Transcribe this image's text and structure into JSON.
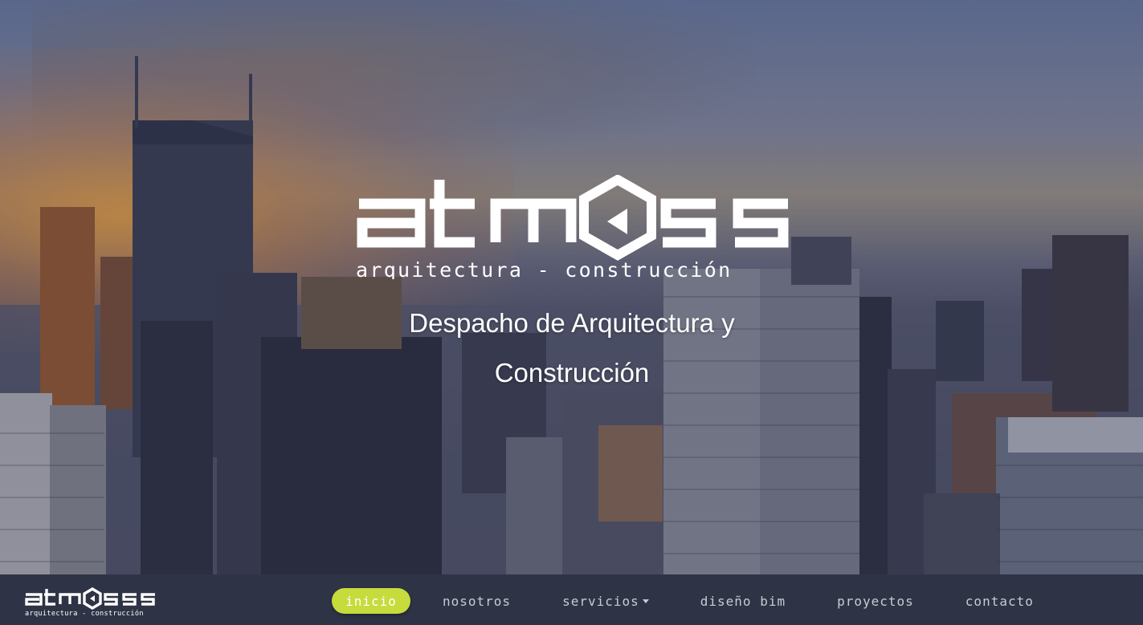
{
  "hero": {
    "logo_text": "atmoss",
    "logo_subtitle": "arquitectura - construcción",
    "tagline": "Despacho de Arquitectura y Construcción"
  },
  "navbar": {
    "brand_text": "atmoss",
    "brand_subtitle": "arquitectura - construcción",
    "items": [
      {
        "label": "inicio",
        "active": true
      },
      {
        "label": "nosotros"
      },
      {
        "label": "servicios",
        "has_dropdown": true
      },
      {
        "label": "diseño bim"
      },
      {
        "label": "proyectos"
      },
      {
        "label": "contacto"
      }
    ]
  },
  "colors": {
    "nav_background": "#2e3345",
    "active_pill": "#c5dc3c",
    "nav_text": "#c9cbd2"
  }
}
